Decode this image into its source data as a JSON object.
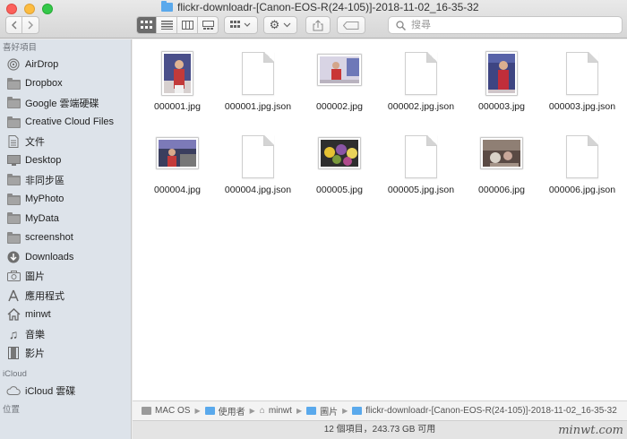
{
  "window": {
    "title": "flickr-downloadr-[Canon-EOS-R(24-105)]-2018-11-02_16-35-32"
  },
  "search": {
    "placeholder": "搜尋"
  },
  "sidebar": {
    "favorites_header": "喜好項目",
    "favorites": [
      {
        "label": "AirDrop",
        "icon": "airdrop-icon"
      },
      {
        "label": "Dropbox",
        "icon": "folder-icon"
      },
      {
        "label": "Google 雲端硬碟",
        "icon": "folder-icon"
      },
      {
        "label": "Creative Cloud Files",
        "icon": "folder-icon"
      },
      {
        "label": "文件",
        "icon": "document-icon"
      },
      {
        "label": "Desktop",
        "icon": "desktop-icon"
      },
      {
        "label": "非同步區",
        "icon": "folder-icon"
      },
      {
        "label": "MyPhoto",
        "icon": "folder-icon"
      },
      {
        "label": "MyData",
        "icon": "folder-icon"
      },
      {
        "label": "screenshot",
        "icon": "folder-icon"
      },
      {
        "label": "Downloads",
        "icon": "download-icon"
      },
      {
        "label": "圖片",
        "icon": "camera-icon"
      },
      {
        "label": "應用程式",
        "icon": "applications-icon"
      },
      {
        "label": "minwt",
        "icon": "home-icon"
      },
      {
        "label": "音樂",
        "icon": "music-icon"
      },
      {
        "label": "影片",
        "icon": "film-icon"
      }
    ],
    "icloud_header": "iCloud",
    "icloud": [
      {
        "label": "iCloud 雲碟",
        "icon": "cloud-icon"
      }
    ],
    "locations_header": "位置"
  },
  "files": [
    {
      "name": "000001.jpg",
      "kind": "photo"
    },
    {
      "name": "000001.jpg.json",
      "kind": "document"
    },
    {
      "name": "000002.jpg",
      "kind": "photo"
    },
    {
      "name": "000002.jpg.json",
      "kind": "document"
    },
    {
      "name": "000003.jpg",
      "kind": "photo"
    },
    {
      "name": "000003.jpg.json",
      "kind": "document"
    },
    {
      "name": "000004.jpg",
      "kind": "photo"
    },
    {
      "name": "000004.jpg.json",
      "kind": "document"
    },
    {
      "name": "000005.jpg",
      "kind": "photo"
    },
    {
      "name": "000005.jpg.json",
      "kind": "document"
    },
    {
      "name": "000006.jpg",
      "kind": "photo"
    },
    {
      "name": "000006.jpg.json",
      "kind": "document"
    }
  ],
  "pathbar": [
    {
      "label": "MAC OS",
      "icon": "disk-icon"
    },
    {
      "label": "使用者",
      "icon": "folder-icon"
    },
    {
      "label": "minwt",
      "icon": "home-icon"
    },
    {
      "label": "圖片",
      "icon": "folder-icon"
    },
    {
      "label": "flickr-downloadr-[Canon-EOS-R(24-105)]-2018-11-02_16-35-32",
      "icon": "folder-icon"
    }
  ],
  "status": {
    "text": "12 個項目，243.73 GB 可用"
  },
  "watermark": "minwt.com",
  "colors": {
    "sidebar_bg": "#dde3ea",
    "folder_blue": "#5aa9ec",
    "selected_view": "#6b6b6b"
  }
}
